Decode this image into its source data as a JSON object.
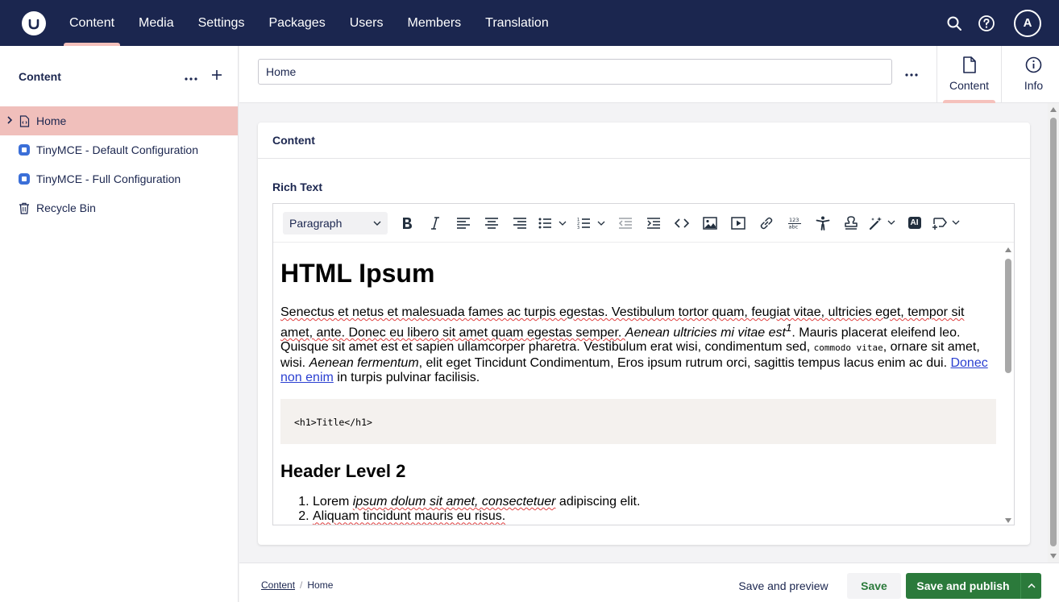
{
  "topbar": {
    "nav": [
      "Content",
      "Media",
      "Settings",
      "Packages",
      "Users",
      "Members",
      "Translation"
    ],
    "active_nav": "Content",
    "avatar_initial": "A"
  },
  "sidebar": {
    "title": "Content",
    "items": [
      {
        "label": "Home",
        "icon": "document-icon",
        "selected": true,
        "has_children": true
      },
      {
        "label": "TinyMCE - Default Configuration",
        "icon": "tinymce-icon",
        "selected": false
      },
      {
        "label": "TinyMCE - Full Configuration",
        "icon": "tinymce-icon",
        "selected": false
      },
      {
        "label": "Recycle Bin",
        "icon": "trash-icon",
        "selected": false
      }
    ]
  },
  "header": {
    "name_value": "Home",
    "apps": [
      {
        "label": "Content",
        "icon": "document-icon",
        "active": true
      },
      {
        "label": "Info",
        "icon": "info-icon",
        "active": false
      }
    ]
  },
  "card": {
    "title": "Content",
    "property_label": "Rich Text"
  },
  "editor": {
    "block_format": "Paragraph",
    "ai_label": "AI",
    "h1": "HTML Ipsum",
    "paragraph": {
      "t1": "Senectus et netus et malesuada fames ac turpis egestas. Vestibulum tortor quam, feugiat vitae, ultricies eget, tempor sit amet, ante. Donec eu libero sit amet quam egestas semper. ",
      "t2": "Aenean ultricies mi vitae est",
      "sup": "1",
      "t3": ". Mauris placerat eleifend leo. Quisque sit amet est et sapien ullamcorper pharetra. Vestibulum erat wisi, condimentum sed, ",
      "code": "commodo vitae",
      "t4": ", ornare sit amet, wisi. ",
      "t5": "Aenean fermentum",
      "t6": ", elit eget Tincidunt Condimentum, Eros ipsum rutrum orci, sagittis tempus lacus enim ac dui. ",
      "link": "Donec non enim",
      "t7": " in turpis pulvinar facilisis."
    },
    "code_block": "<h1>Title</h1>",
    "h2": "Header Level 2",
    "list": [
      {
        "a": "Lorem ",
        "b": "ipsum dolum sit amet, consectetuer",
        "c": " adipiscing elit."
      },
      {
        "a": "Aliquam tincidunt mauris eu risus.",
        "b": "",
        "c": ""
      }
    ]
  },
  "footer": {
    "breadcrumb": [
      "Content",
      "Home"
    ],
    "save_preview": "Save and preview",
    "save": "Save",
    "save_publish": "Save and publish"
  },
  "colors": {
    "topbar": "#1b264f",
    "accent": "#f5c1bc",
    "selected_row": "#f0bfbb",
    "publish": "#2b7a3b"
  }
}
